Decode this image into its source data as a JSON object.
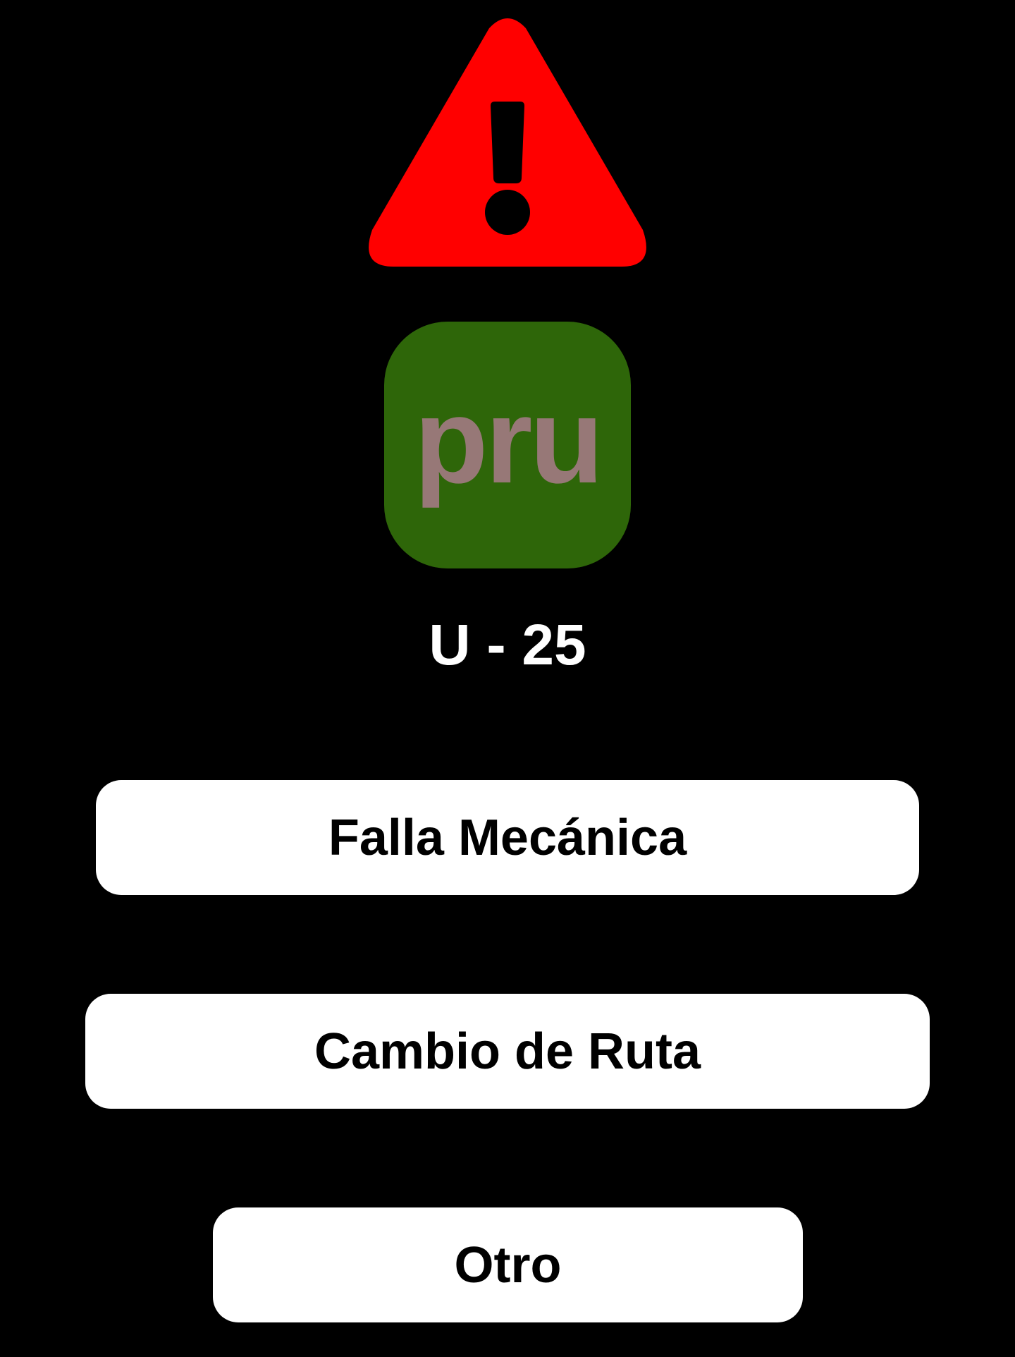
{
  "alert": {
    "icon": "warning-triangle-icon",
    "color": "#ff0000"
  },
  "route": {
    "label": "pru",
    "badge_color": "#2e6609",
    "text_color": "#977877"
  },
  "unit": {
    "label": "U - 25"
  },
  "options": {
    "mechanical_failure_label": "Falla Mecánica",
    "route_change_label": "Cambio de Ruta",
    "other_label": "Otro"
  }
}
